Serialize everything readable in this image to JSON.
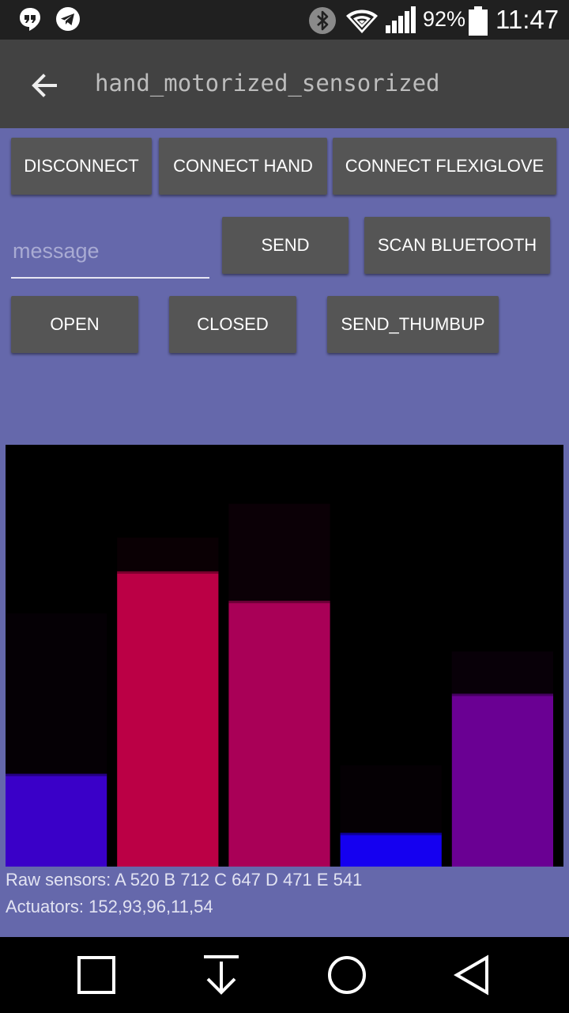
{
  "status_bar": {
    "battery": "92%",
    "time": "11:47",
    "icons": [
      "hangouts-icon",
      "telegram-icon",
      "bluetooth-icon",
      "wifi-icon",
      "signal-icon",
      "battery-icon"
    ]
  },
  "toolbar": {
    "title": "hand_motorized_sensorized"
  },
  "buttons": {
    "disconnect": "DISCONNECT",
    "connect_hand": "CONNECT HAND",
    "connect_flexiglove": "CONNECT FLEXIGLOVE",
    "send": "SEND",
    "scan_bluetooth": "SCAN BLUETOOTH",
    "open": "OPEN",
    "closed": "CLOSED",
    "send_thumbup": "SEND_THUMBUP"
  },
  "message": {
    "value": "",
    "placeholder": "message"
  },
  "chart_data": {
    "type": "bar",
    "ylim": [
      0,
      1
    ],
    "series": [
      {
        "values": [
          0.22,
          0.7,
          0.63,
          0.08,
          0.41
        ],
        "colors": [
          "#3a00c8",
          "#bb0045",
          "#a90057",
          "#1500f0",
          "#6a0093"
        ]
      },
      {
        "values": [
          0.6,
          0.78,
          0.86,
          0.24,
          0.51
        ],
        "colors": [
          "#050005",
          "#0a0004",
          "#0b0006",
          "#050004",
          "#080008"
        ]
      }
    ]
  },
  "readouts": {
    "raw_sensors": "Raw sensors: A 520 B 712 C 647 D 471 E 541",
    "actuators": "Actuators: 152,93,96,11,54"
  },
  "colors": {
    "status_bar": "#202020",
    "toolbar": "#424242",
    "background": "#6568ab",
    "button": "#555555"
  },
  "nav_bar": {
    "icons": [
      "recents-icon",
      "notifications-down-icon",
      "home-icon",
      "back-icon"
    ]
  }
}
